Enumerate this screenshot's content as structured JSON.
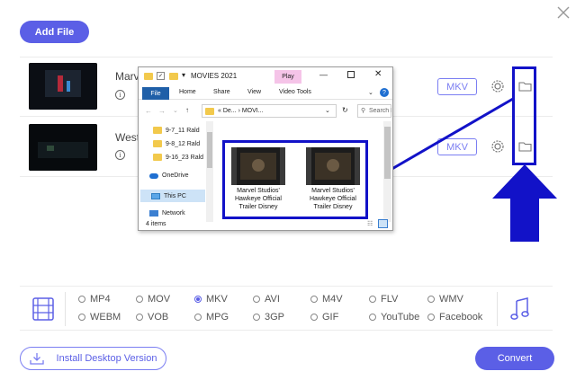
{
  "toolbar": {
    "add_file_label": "Add File"
  },
  "files": [
    {
      "name": "Marv",
      "format": "MKV"
    },
    {
      "name": "West",
      "format": "MKV"
    }
  ],
  "explorer": {
    "title": "MOVIES 2021",
    "play_tag": "Play",
    "menu": [
      "File",
      "Home",
      "Share",
      "View",
      "Video Tools"
    ],
    "address": "« De... › MOVI...",
    "search_placeholder": "Search M...",
    "folders": [
      "9-7_11 Rald",
      "9-8_12 Rald",
      "9-16_23 Rald"
    ],
    "nav": [
      "OneDrive",
      "This PC",
      "Network"
    ],
    "items_count": "4 items",
    "videos": [
      {
        "caption": "Marvel Studios' Hawkeye Official Trailer Disney"
      },
      {
        "caption": "Marvel Studios' Hawkeye Official Trailer Disney"
      }
    ]
  },
  "formats": {
    "row1": [
      "MP4",
      "MOV",
      "MKV",
      "AVI",
      "M4V",
      "FLV",
      "WMV"
    ],
    "row2": [
      "WEBM",
      "VOB",
      "MPG",
      "3GP",
      "GIF",
      "YouTube",
      "Facebook"
    ],
    "selected": "MKV"
  },
  "footer": {
    "install_label": "Install Desktop Version",
    "convert_label": "Convert"
  },
  "colors": {
    "accent": "#5b5fe6",
    "highlight": "#1212c8"
  }
}
